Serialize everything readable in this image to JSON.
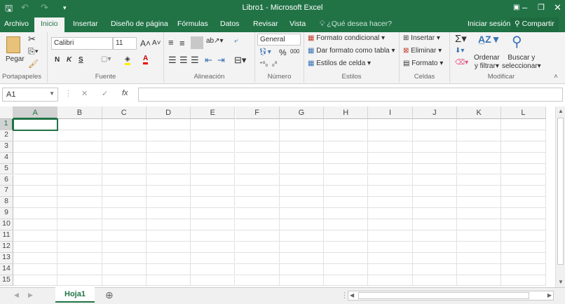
{
  "title": "Libro1 - Microsoft Excel",
  "tabs": [
    "Archivo",
    "Inicio",
    "Insertar",
    "Diseño de página",
    "Fórmulas",
    "Datos",
    "Revisar",
    "Vista"
  ],
  "tell_me": "¿Qué desea hacer?",
  "signin": "Iniciar sesión",
  "share": "Compartir",
  "clipboard": {
    "paste": "Pegar",
    "label": "Portapapeles"
  },
  "font": {
    "name": "Calibri",
    "size": "11",
    "bold": "N",
    "italic": "K",
    "underline": "S",
    "label": "Fuente"
  },
  "alignment": {
    "label": "Alineación"
  },
  "number": {
    "format": "General",
    "percent": "%",
    "thousands": "000",
    "label": "Número"
  },
  "styles": {
    "items": [
      "Formato condicional",
      "Dar formato como tabla",
      "Estilos de celda"
    ],
    "label": "Estilos"
  },
  "cells": {
    "items": [
      "Insertar",
      "Eliminar",
      "Formato"
    ],
    "label": "Celdas"
  },
  "editing": {
    "sort": [
      "Ordenar",
      "y filtrar"
    ],
    "find": [
      "Buscar y",
      "seleccionar"
    ],
    "label": "Modificar"
  },
  "namebox": "A1",
  "fx": "fx",
  "columns": [
    "A",
    "B",
    "C",
    "D",
    "E",
    "F",
    "G",
    "H",
    "I",
    "J",
    "K",
    "L"
  ],
  "rows": [
    "1",
    "2",
    "3",
    "4",
    "5",
    "6",
    "7",
    "8",
    "9",
    "10",
    "11",
    "12",
    "13",
    "14",
    "15"
  ],
  "sheet": "Hoja1",
  "colors": {
    "brand": "#217346"
  }
}
